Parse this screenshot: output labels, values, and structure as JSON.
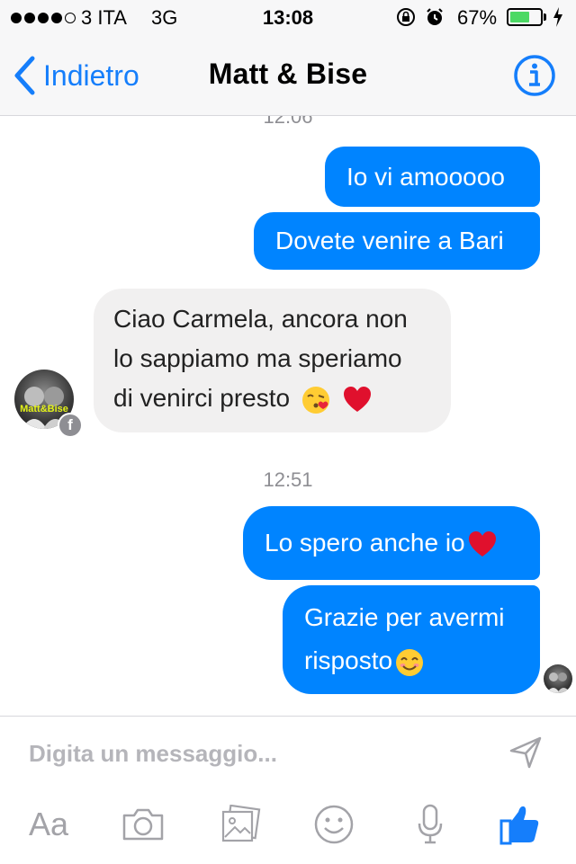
{
  "status_bar": {
    "carrier": "3 ITA",
    "network": "3G",
    "time": "13:08",
    "battery_percent": "67%",
    "battery_level": 0.67,
    "icons": [
      "orientation-lock-icon",
      "alarm-icon",
      "charging-bolt-icon"
    ]
  },
  "nav": {
    "back_label": "Indietro",
    "title": "Matt & Bise",
    "info_icon": "info-icon",
    "accent_color": "#157efb"
  },
  "messages": {
    "partial_timestamp": "12:06",
    "outgoing_1": "Io vi amooooo",
    "outgoing_2": "Dovete venire a Bari",
    "incoming_1": {
      "line1": "Ciao Carmela, ancora non",
      "line2": "lo sappiamo ma speriamo",
      "line3": "di venirci presto",
      "emojis": [
        "kiss-emoji",
        "red-heart-emoji"
      ]
    },
    "avatar_caption": "Matt&Bise",
    "timestamp_2": "12:51",
    "outgoing_3": {
      "text": "Lo spero anche io",
      "emoji": "red-heart-emoji"
    },
    "outgoing_4": {
      "line1": "Grazie per avermi",
      "line2": "risposto",
      "emoji": "smiling-emoji"
    },
    "colors": {
      "outgoing_bubble": "#0084ff",
      "incoming_bubble": "#f1f0f0"
    }
  },
  "composer": {
    "placeholder": "Digita un messaggio...",
    "send_icon": "send-arrow-icon",
    "tools": {
      "text_label": "Aa",
      "camera_icon": "camera-icon",
      "gallery_icon": "gallery-icon",
      "emoji_icon": "smiley-icon",
      "mic_icon": "microphone-icon",
      "like_icon": "thumbs-up-icon"
    }
  }
}
